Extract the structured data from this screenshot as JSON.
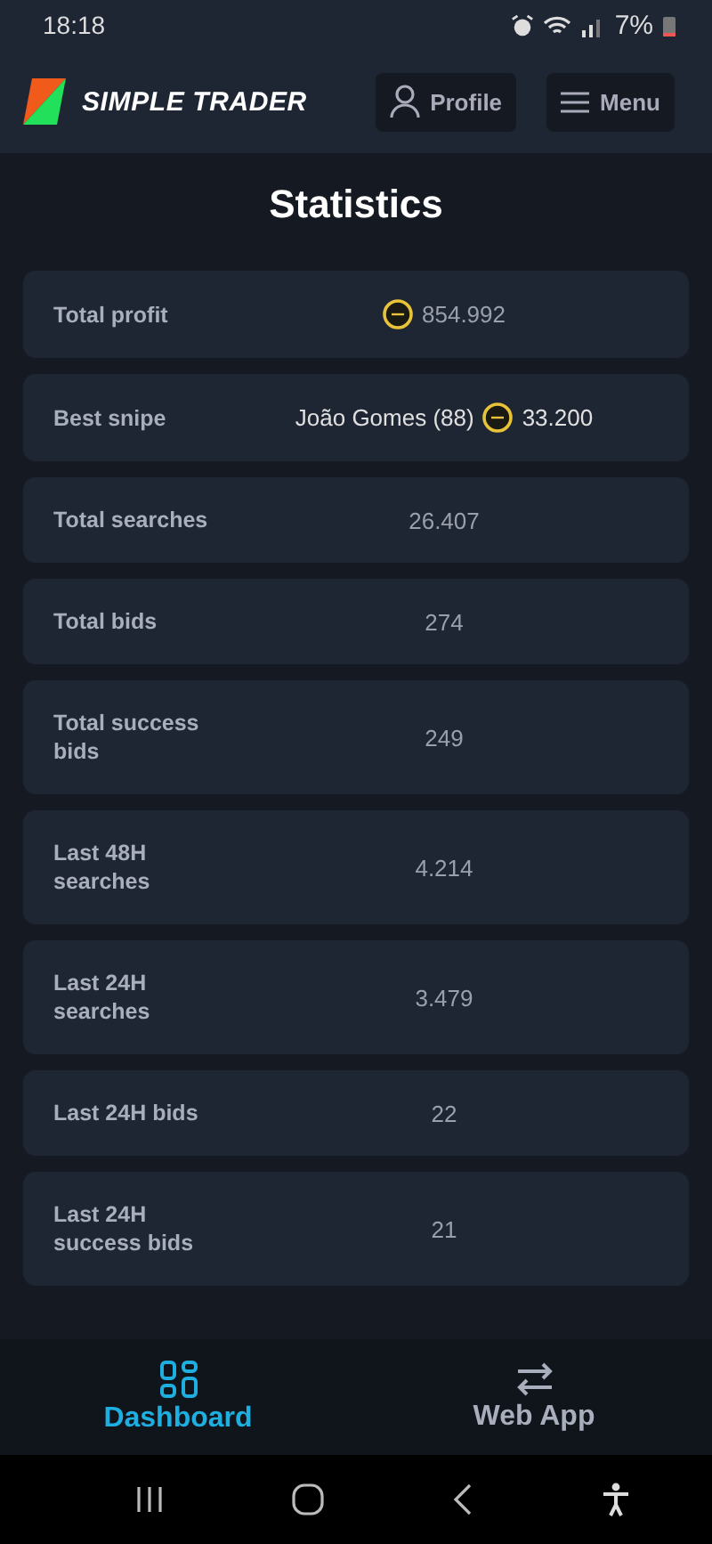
{
  "status_bar": {
    "time": "18:18",
    "battery": "7%"
  },
  "header": {
    "brand": "SIMPLE TRADER",
    "buttons": [
      {
        "kind": "profile",
        "label": "Profile"
      },
      {
        "kind": "menu",
        "label": "Menu"
      }
    ]
  },
  "title": "Statistics",
  "stats": [
    {
      "label": "Total profit",
      "coin": true,
      "value": "854.992"
    },
    {
      "label": "Best snipe",
      "player": "João Gomes (88)",
      "coin": true,
      "value": "33.200"
    },
    {
      "label": "Total searches",
      "coin": false,
      "value": "26.407"
    },
    {
      "label": "Total bids",
      "coin": false,
      "value": "274"
    },
    {
      "label": "Total success bids",
      "coin": false,
      "value": "249"
    },
    {
      "label": "Last 48H searches",
      "coin": false,
      "value": "4.214"
    },
    {
      "label": "Last 24H searches",
      "coin": false,
      "value": "3.479"
    },
    {
      "label": "Last 24H bids",
      "coin": false,
      "value": "22"
    },
    {
      "label": "Last 24H success bids",
      "coin": false,
      "value": "21"
    }
  ],
  "bottom_nav": [
    {
      "kind": "dashboard",
      "label": "Dashboard",
      "selected": true
    },
    {
      "kind": "webapp",
      "label": "Web App",
      "selected": false
    }
  ]
}
